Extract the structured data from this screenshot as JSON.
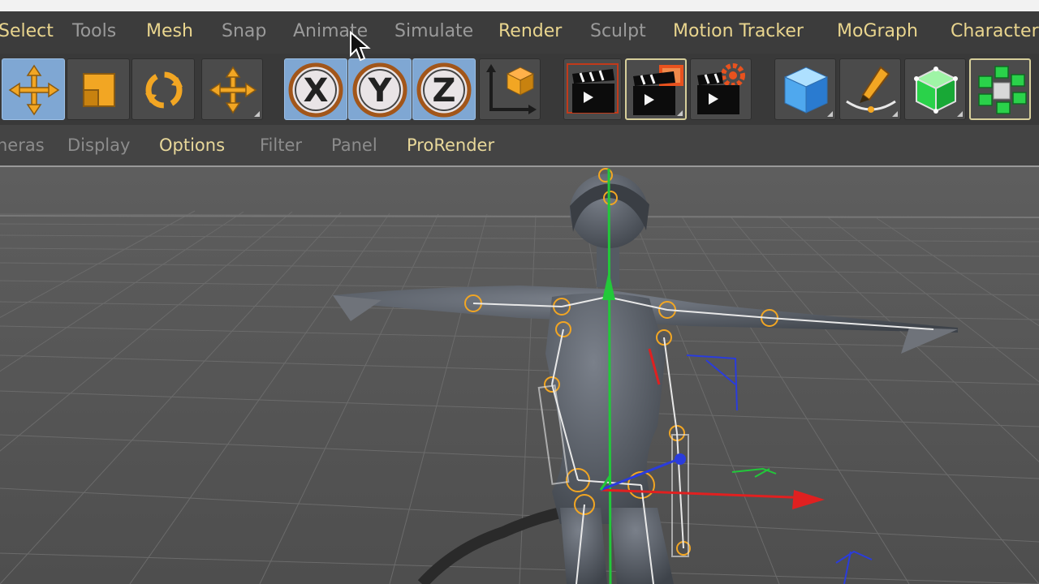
{
  "menu": {
    "items": [
      {
        "label": "Select",
        "state": "active"
      },
      {
        "label": "Tools",
        "state": "dim"
      },
      {
        "label": "Mesh",
        "state": "active"
      },
      {
        "label": "Snap",
        "state": "dim"
      },
      {
        "label": "Animate",
        "state": "dim"
      },
      {
        "label": "Simulate",
        "state": "dim"
      },
      {
        "label": "Render",
        "state": "active"
      },
      {
        "label": "Sculpt",
        "state": "dim"
      },
      {
        "label": "Motion Tracker",
        "state": "active"
      },
      {
        "label": "MoGraph",
        "state": "active"
      },
      {
        "label": "Character",
        "state": "active"
      }
    ]
  },
  "toolbar": {
    "x_label": "X",
    "y_label": "Y",
    "z_label": "Z"
  },
  "viewport_menu": {
    "items": [
      {
        "label": "neras",
        "state": "dim"
      },
      {
        "label": "Display",
        "state": "dim"
      },
      {
        "label": "Options",
        "state": "active"
      },
      {
        "label": "Filter",
        "state": "dim"
      },
      {
        "label": "Panel",
        "state": "dim"
      },
      {
        "label": "ProRender",
        "state": "active"
      }
    ]
  },
  "colors": {
    "accent_orange": "#f2a623",
    "menu_active": "#e9d58e",
    "selected_button": "#7fa7d3",
    "axis_x": "#e02020",
    "axis_y": "#22c83a",
    "axis_z": "#2a3cdc"
  }
}
